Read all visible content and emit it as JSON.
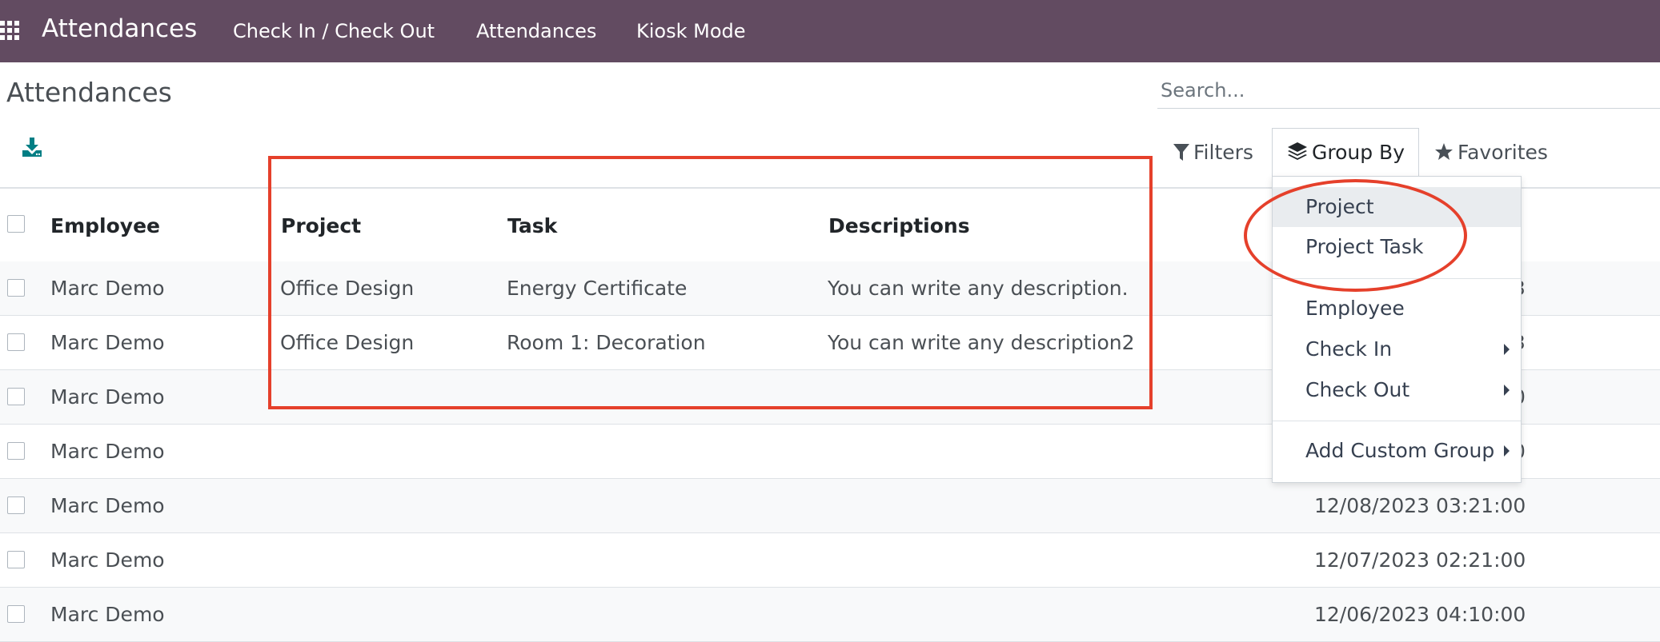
{
  "app": {
    "brand": "Attendances",
    "nav": [
      "Check In / Check Out",
      "Attendances",
      "Kiosk Mode"
    ]
  },
  "page": {
    "title": "Attendances",
    "search_placeholder": "Search..."
  },
  "toolbar": {
    "filters": "Filters",
    "group_by": "Group By",
    "favorites": "Favorites"
  },
  "table": {
    "headers": {
      "employee": "Employee",
      "project": "Project",
      "task": "Task",
      "descriptions": "Descriptions"
    },
    "rows": [
      {
        "employee": "Marc Demo",
        "project": "Office Design",
        "task": "Energy Certificate",
        "description": "You can write any description.",
        "check_in": "",
        "suffix": "3"
      },
      {
        "employee": "Marc Demo",
        "project": "Office Design",
        "task": "Room 1: Decoration",
        "description": "You can write any description2",
        "check_in": "",
        "suffix": "3"
      },
      {
        "employee": "Marc Demo",
        "project": "",
        "task": "",
        "description": "",
        "check_in": "",
        "suffix": "0"
      },
      {
        "employee": "Marc Demo",
        "project": "",
        "task": "",
        "description": "",
        "check_in": "",
        "suffix": "0"
      },
      {
        "employee": "Marc Demo",
        "project": "",
        "task": "",
        "description": "",
        "check_in": "12/08/2023 03:21:00",
        "suffix": ""
      },
      {
        "employee": "Marc Demo",
        "project": "",
        "task": "",
        "description": "",
        "check_in": "12/07/2023 02:21:00",
        "suffix": ""
      },
      {
        "employee": "Marc Demo",
        "project": "",
        "task": "",
        "description": "",
        "check_in": "12/06/2023 04:10:00",
        "suffix": ""
      }
    ]
  },
  "group_by_menu": {
    "items": [
      "Project",
      "Project Task",
      "Employee",
      "Check In",
      "Check Out",
      "Add Custom Group"
    ],
    "active_item": "Project"
  },
  "colors": {
    "topbar": "#624b61",
    "highlight": "#e5402b",
    "action_icon": "#017e84"
  }
}
